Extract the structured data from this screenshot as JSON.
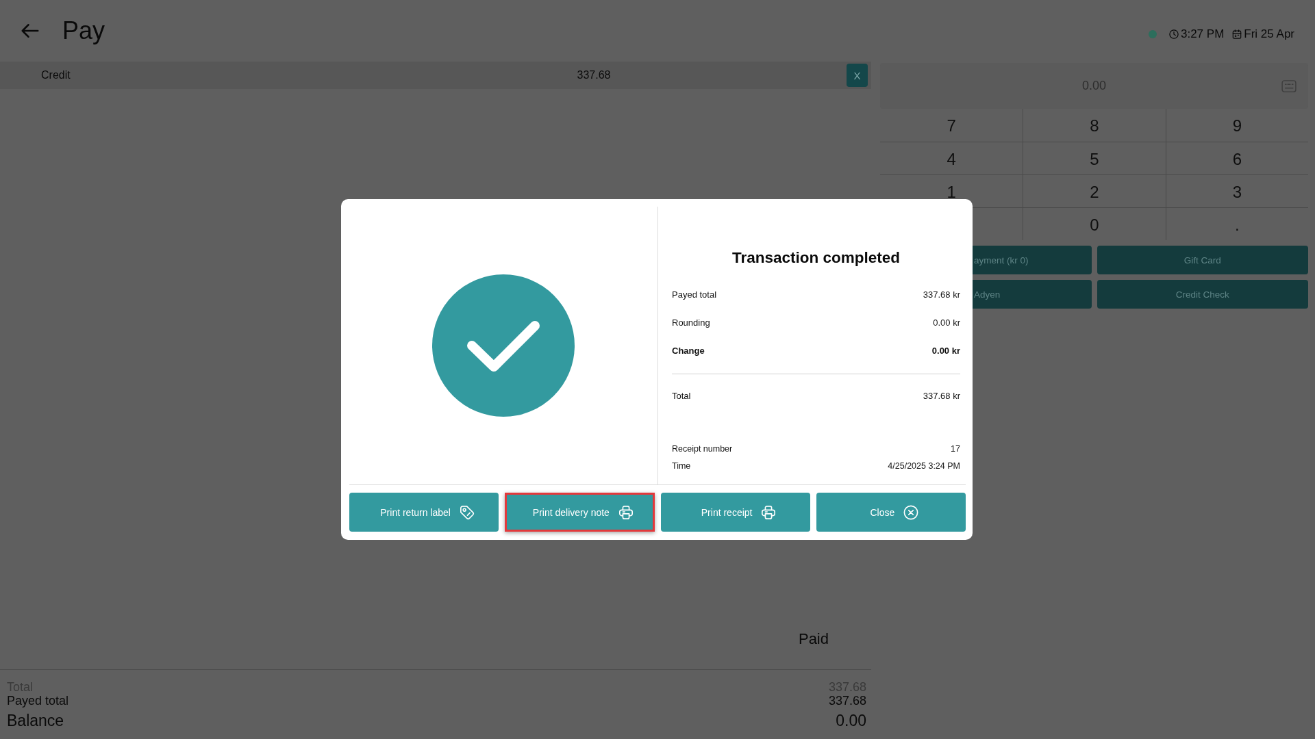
{
  "header": {
    "title": "Pay",
    "connected": true,
    "time": "3:27 PM",
    "date": "Fri 25 Apr"
  },
  "payments": [
    {
      "method": "Credit",
      "amount": "337.68",
      "remove_label": "X"
    }
  ],
  "paid_label": "Paid",
  "summary": [
    {
      "label": "Total",
      "value": "337.68",
      "kind": "muted"
    },
    {
      "label": "Payed total",
      "value": "337.68",
      "kind": "plain"
    },
    {
      "label": "Balance",
      "value": "0.00",
      "kind": "emphasis"
    }
  ],
  "keypad": {
    "display": "0.00",
    "rows": [
      [
        "7",
        "8",
        "9"
      ],
      [
        "4",
        "5",
        "6"
      ],
      [
        "1",
        "2",
        "3"
      ],
      [
        "",
        "0",
        "."
      ]
    ]
  },
  "payment_methods": [
    "ayment (kr 0)",
    "Gift Card",
    "Adyen",
    "Credit Check"
  ],
  "dialog": {
    "title": "Transaction completed",
    "lines": [
      {
        "label": "Payed total",
        "value": "337.68 kr",
        "bold": false
      },
      {
        "label": "Rounding",
        "value": "0.00 kr",
        "bold": false
      },
      {
        "label": "Change",
        "value": "0.00 kr",
        "bold": true
      }
    ],
    "total": {
      "label": "Total",
      "value": "337.68 kr"
    },
    "receipt_info": [
      {
        "label": "Receipt number",
        "value": "17"
      },
      {
        "label": "Time",
        "value": "4/25/2025 3:24 PM"
      }
    ],
    "actions": [
      {
        "label": "Print return label",
        "kind": "label",
        "highlighted": false
      },
      {
        "label": "Print delivery note",
        "kind": "print",
        "highlighted": true
      },
      {
        "label": "Print receipt",
        "kind": "print",
        "highlighted": false
      },
      {
        "label": "Close",
        "kind": "close",
        "highlighted": false
      }
    ]
  }
}
